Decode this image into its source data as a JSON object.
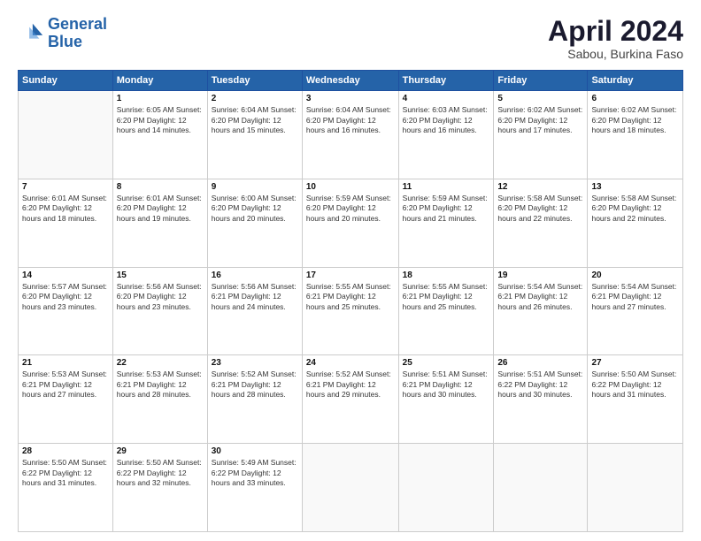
{
  "header": {
    "logo_line1": "General",
    "logo_line2": "Blue",
    "month": "April 2024",
    "location": "Sabou, Burkina Faso"
  },
  "weekdays": [
    "Sunday",
    "Monday",
    "Tuesday",
    "Wednesday",
    "Thursday",
    "Friday",
    "Saturday"
  ],
  "weeks": [
    [
      {
        "day": "",
        "info": ""
      },
      {
        "day": "1",
        "info": "Sunrise: 6:05 AM\nSunset: 6:20 PM\nDaylight: 12 hours\nand 14 minutes."
      },
      {
        "day": "2",
        "info": "Sunrise: 6:04 AM\nSunset: 6:20 PM\nDaylight: 12 hours\nand 15 minutes."
      },
      {
        "day": "3",
        "info": "Sunrise: 6:04 AM\nSunset: 6:20 PM\nDaylight: 12 hours\nand 16 minutes."
      },
      {
        "day": "4",
        "info": "Sunrise: 6:03 AM\nSunset: 6:20 PM\nDaylight: 12 hours\nand 16 minutes."
      },
      {
        "day": "5",
        "info": "Sunrise: 6:02 AM\nSunset: 6:20 PM\nDaylight: 12 hours\nand 17 minutes."
      },
      {
        "day": "6",
        "info": "Sunrise: 6:02 AM\nSunset: 6:20 PM\nDaylight: 12 hours\nand 18 minutes."
      }
    ],
    [
      {
        "day": "7",
        "info": "Sunrise: 6:01 AM\nSunset: 6:20 PM\nDaylight: 12 hours\nand 18 minutes."
      },
      {
        "day": "8",
        "info": "Sunrise: 6:01 AM\nSunset: 6:20 PM\nDaylight: 12 hours\nand 19 minutes."
      },
      {
        "day": "9",
        "info": "Sunrise: 6:00 AM\nSunset: 6:20 PM\nDaylight: 12 hours\nand 20 minutes."
      },
      {
        "day": "10",
        "info": "Sunrise: 5:59 AM\nSunset: 6:20 PM\nDaylight: 12 hours\nand 20 minutes."
      },
      {
        "day": "11",
        "info": "Sunrise: 5:59 AM\nSunset: 6:20 PM\nDaylight: 12 hours\nand 21 minutes."
      },
      {
        "day": "12",
        "info": "Sunrise: 5:58 AM\nSunset: 6:20 PM\nDaylight: 12 hours\nand 22 minutes."
      },
      {
        "day": "13",
        "info": "Sunrise: 5:58 AM\nSunset: 6:20 PM\nDaylight: 12 hours\nand 22 minutes."
      }
    ],
    [
      {
        "day": "14",
        "info": "Sunrise: 5:57 AM\nSunset: 6:20 PM\nDaylight: 12 hours\nand 23 minutes."
      },
      {
        "day": "15",
        "info": "Sunrise: 5:56 AM\nSunset: 6:20 PM\nDaylight: 12 hours\nand 23 minutes."
      },
      {
        "day": "16",
        "info": "Sunrise: 5:56 AM\nSunset: 6:21 PM\nDaylight: 12 hours\nand 24 minutes."
      },
      {
        "day": "17",
        "info": "Sunrise: 5:55 AM\nSunset: 6:21 PM\nDaylight: 12 hours\nand 25 minutes."
      },
      {
        "day": "18",
        "info": "Sunrise: 5:55 AM\nSunset: 6:21 PM\nDaylight: 12 hours\nand 25 minutes."
      },
      {
        "day": "19",
        "info": "Sunrise: 5:54 AM\nSunset: 6:21 PM\nDaylight: 12 hours\nand 26 minutes."
      },
      {
        "day": "20",
        "info": "Sunrise: 5:54 AM\nSunset: 6:21 PM\nDaylight: 12 hours\nand 27 minutes."
      }
    ],
    [
      {
        "day": "21",
        "info": "Sunrise: 5:53 AM\nSunset: 6:21 PM\nDaylight: 12 hours\nand 27 minutes."
      },
      {
        "day": "22",
        "info": "Sunrise: 5:53 AM\nSunset: 6:21 PM\nDaylight: 12 hours\nand 28 minutes."
      },
      {
        "day": "23",
        "info": "Sunrise: 5:52 AM\nSunset: 6:21 PM\nDaylight: 12 hours\nand 28 minutes."
      },
      {
        "day": "24",
        "info": "Sunrise: 5:52 AM\nSunset: 6:21 PM\nDaylight: 12 hours\nand 29 minutes."
      },
      {
        "day": "25",
        "info": "Sunrise: 5:51 AM\nSunset: 6:21 PM\nDaylight: 12 hours\nand 30 minutes."
      },
      {
        "day": "26",
        "info": "Sunrise: 5:51 AM\nSunset: 6:22 PM\nDaylight: 12 hours\nand 30 minutes."
      },
      {
        "day": "27",
        "info": "Sunrise: 5:50 AM\nSunset: 6:22 PM\nDaylight: 12 hours\nand 31 minutes."
      }
    ],
    [
      {
        "day": "28",
        "info": "Sunrise: 5:50 AM\nSunset: 6:22 PM\nDaylight: 12 hours\nand 31 minutes."
      },
      {
        "day": "29",
        "info": "Sunrise: 5:50 AM\nSunset: 6:22 PM\nDaylight: 12 hours\nand 32 minutes."
      },
      {
        "day": "30",
        "info": "Sunrise: 5:49 AM\nSunset: 6:22 PM\nDaylight: 12 hours\nand 33 minutes."
      },
      {
        "day": "",
        "info": ""
      },
      {
        "day": "",
        "info": ""
      },
      {
        "day": "",
        "info": ""
      },
      {
        "day": "",
        "info": ""
      }
    ]
  ]
}
